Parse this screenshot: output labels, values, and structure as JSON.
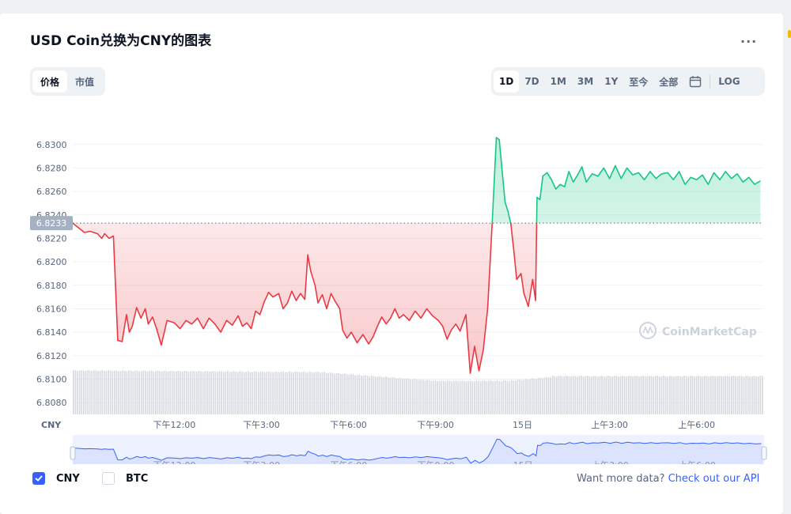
{
  "title": "USD Coin兑换为CNY的图表",
  "more_label": "...",
  "metric_tabs": [
    {
      "label": "价格",
      "active": true
    },
    {
      "label": "市值",
      "active": false
    }
  ],
  "range_tabs": [
    {
      "label": "1D",
      "active": true
    },
    {
      "label": "7D",
      "active": false
    },
    {
      "label": "1M",
      "active": false
    },
    {
      "label": "3M",
      "active": false
    },
    {
      "label": "1Y",
      "active": false
    },
    {
      "label": "至今",
      "active": false
    },
    {
      "label": "全部",
      "active": false
    }
  ],
  "calendar_icon": "calendar-icon",
  "log_label": "LOG",
  "watermark": "CoinMarketCap",
  "legend": [
    {
      "label": "CNY",
      "checked": true
    },
    {
      "label": "BTC",
      "checked": false
    }
  ],
  "api_text": "Want more data?",
  "api_link": "Check out our API",
  "colors": {
    "up": "#16c784",
    "down": "#ea3943",
    "accent": "#3861fb",
    "text": "#58667e",
    "volume": "#d7dae0"
  },
  "chart_data": {
    "type": "line",
    "currency_label": "CNY",
    "baseline": 6.8233,
    "baseline_label": "6.8233",
    "ylim": [
      6.807,
      6.8315
    ],
    "yticks": [
      "6.8300",
      "6.8280",
      "6.8260",
      "6.8240",
      "6.8220",
      "6.8200",
      "6.8180",
      "6.8160",
      "6.8140",
      "6.8120",
      "6.8100",
      "6.8080"
    ],
    "xticks": [
      "下午12:00",
      "下午3:00",
      "下午6:00",
      "下午9:00",
      "15日",
      "上午3:00",
      "上午6:00"
    ],
    "xtick_hours": [
      12,
      15,
      18,
      21,
      24,
      27,
      30
    ],
    "xlim": [
      8.5,
      32.3
    ],
    "grid": true,
    "series": [
      {
        "values": [
          [
            8.5,
            6.8233
          ],
          [
            8.9,
            6.8225
          ],
          [
            9.1,
            6.8226
          ],
          [
            9.35,
            6.8224
          ],
          [
            9.5,
            6.822
          ],
          [
            9.6,
            6.8224
          ],
          [
            9.75,
            6.822
          ],
          [
            9.9,
            6.8222
          ],
          [
            10.05,
            6.8133
          ],
          [
            10.2,
            6.8132
          ],
          [
            10.35,
            6.8155
          ],
          [
            10.45,
            6.814
          ],
          [
            10.55,
            6.8145
          ],
          [
            10.7,
            6.8161
          ],
          [
            10.85,
            6.8152
          ],
          [
            11.0,
            6.816
          ],
          [
            11.1,
            6.8147
          ],
          [
            11.25,
            6.8153
          ],
          [
            11.4,
            6.8142
          ],
          [
            11.55,
            6.8129
          ],
          [
            11.75,
            6.815
          ],
          [
            12.0,
            6.8148
          ],
          [
            12.2,
            6.8143
          ],
          [
            12.4,
            6.815
          ],
          [
            12.6,
            6.8147
          ],
          [
            12.8,
            6.8152
          ],
          [
            13.0,
            6.8143
          ],
          [
            13.2,
            6.8152
          ],
          [
            13.4,
            6.8147
          ],
          [
            13.6,
            6.814
          ],
          [
            13.8,
            6.815
          ],
          [
            14.0,
            6.8146
          ],
          [
            14.2,
            6.8154
          ],
          [
            14.35,
            6.8145
          ],
          [
            14.5,
            6.8148
          ],
          [
            14.65,
            6.8143
          ],
          [
            14.8,
            6.8158
          ],
          [
            14.95,
            6.8155
          ],
          [
            15.1,
            6.8166
          ],
          [
            15.25,
            6.8174
          ],
          [
            15.4,
            6.817
          ],
          [
            15.6,
            6.8173
          ],
          [
            15.75,
            6.816
          ],
          [
            15.9,
            6.8165
          ],
          [
            16.05,
            6.8175
          ],
          [
            16.2,
            6.8167
          ],
          [
            16.35,
            6.8173
          ],
          [
            16.5,
            6.8168
          ],
          [
            16.6,
            6.8206
          ],
          [
            16.7,
            6.8192
          ],
          [
            16.85,
            6.818
          ],
          [
            16.95,
            6.8165
          ],
          [
            17.1,
            6.8172
          ],
          [
            17.25,
            6.816
          ],
          [
            17.4,
            6.8173
          ],
          [
            17.55,
            6.8166
          ],
          [
            17.7,
            6.816
          ],
          [
            17.8,
            6.8142
          ],
          [
            17.95,
            6.8135
          ],
          [
            18.1,
            6.814
          ],
          [
            18.3,
            6.8131
          ],
          [
            18.5,
            6.8138
          ],
          [
            18.7,
            6.813
          ],
          [
            18.85,
            6.8136
          ],
          [
            19.0,
            6.8145
          ],
          [
            19.15,
            6.8153
          ],
          [
            19.3,
            6.8147
          ],
          [
            19.45,
            6.8152
          ],
          [
            19.6,
            6.816
          ],
          [
            19.75,
            6.8152
          ],
          [
            19.9,
            6.8155
          ],
          [
            20.1,
            6.815
          ],
          [
            20.3,
            6.8158
          ],
          [
            20.5,
            6.8152
          ],
          [
            20.7,
            6.816
          ],
          [
            20.9,
            6.8154
          ],
          [
            21.1,
            6.815
          ],
          [
            21.25,
            6.8145
          ],
          [
            21.4,
            6.8134
          ],
          [
            21.55,
            6.8142
          ],
          [
            21.7,
            6.8147
          ],
          [
            21.85,
            6.8141
          ],
          [
            22.05,
            6.8155
          ],
          [
            22.2,
            6.8105
          ],
          [
            22.35,
            6.8128
          ],
          [
            22.5,
            6.8107
          ],
          [
            22.65,
            6.8125
          ],
          [
            22.8,
            6.816
          ],
          [
            22.95,
            6.823
          ],
          [
            23.1,
            6.8306
          ],
          [
            23.2,
            6.8304
          ],
          [
            23.4,
            6.8251
          ],
          [
            23.5,
            6.8243
          ],
          [
            23.6,
            6.8232
          ],
          [
            23.7,
            6.821
          ],
          [
            23.8,
            6.8185
          ],
          [
            23.95,
            6.819
          ],
          [
            24.05,
            6.8173
          ],
          [
            24.2,
            6.8162
          ],
          [
            24.35,
            6.8185
          ],
          [
            24.45,
            6.8167
          ],
          [
            24.5,
            6.8255
          ],
          [
            24.6,
            6.8253
          ],
          [
            24.7,
            6.8273
          ],
          [
            24.85,
            6.8276
          ],
          [
            25.0,
            6.827
          ],
          [
            25.15,
            6.8262
          ],
          [
            25.3,
            6.8266
          ],
          [
            25.45,
            6.8264
          ],
          [
            25.6,
            6.8277
          ],
          [
            25.75,
            6.8268
          ],
          [
            25.9,
            6.8274
          ],
          [
            26.05,
            6.8281
          ],
          [
            26.2,
            6.8268
          ],
          [
            26.4,
            6.8275
          ],
          [
            26.6,
            6.8273
          ],
          [
            26.8,
            6.828
          ],
          [
            27.0,
            6.8271
          ],
          [
            27.2,
            6.8282
          ],
          [
            27.4,
            6.8271
          ],
          [
            27.6,
            6.828
          ],
          [
            27.8,
            6.8274
          ],
          [
            28.0,
            6.8276
          ],
          [
            28.2,
            6.827
          ],
          [
            28.4,
            6.8277
          ],
          [
            28.6,
            6.8271
          ],
          [
            28.8,
            6.8275
          ],
          [
            29.0,
            6.8276
          ],
          [
            29.2,
            6.827
          ],
          [
            29.4,
            6.8277
          ],
          [
            29.6,
            6.8266
          ],
          [
            29.8,
            6.8272
          ],
          [
            30.0,
            6.827
          ],
          [
            30.2,
            6.8274
          ],
          [
            30.4,
            6.8266
          ],
          [
            30.6,
            6.8276
          ],
          [
            30.8,
            6.827
          ],
          [
            31.0,
            6.8277
          ],
          [
            31.2,
            6.8271
          ],
          [
            31.4,
            6.8275
          ],
          [
            31.6,
            6.8268
          ],
          [
            31.8,
            6.8272
          ],
          [
            32.0,
            6.8266
          ],
          [
            32.2,
            6.8269
          ]
        ]
      }
    ]
  }
}
